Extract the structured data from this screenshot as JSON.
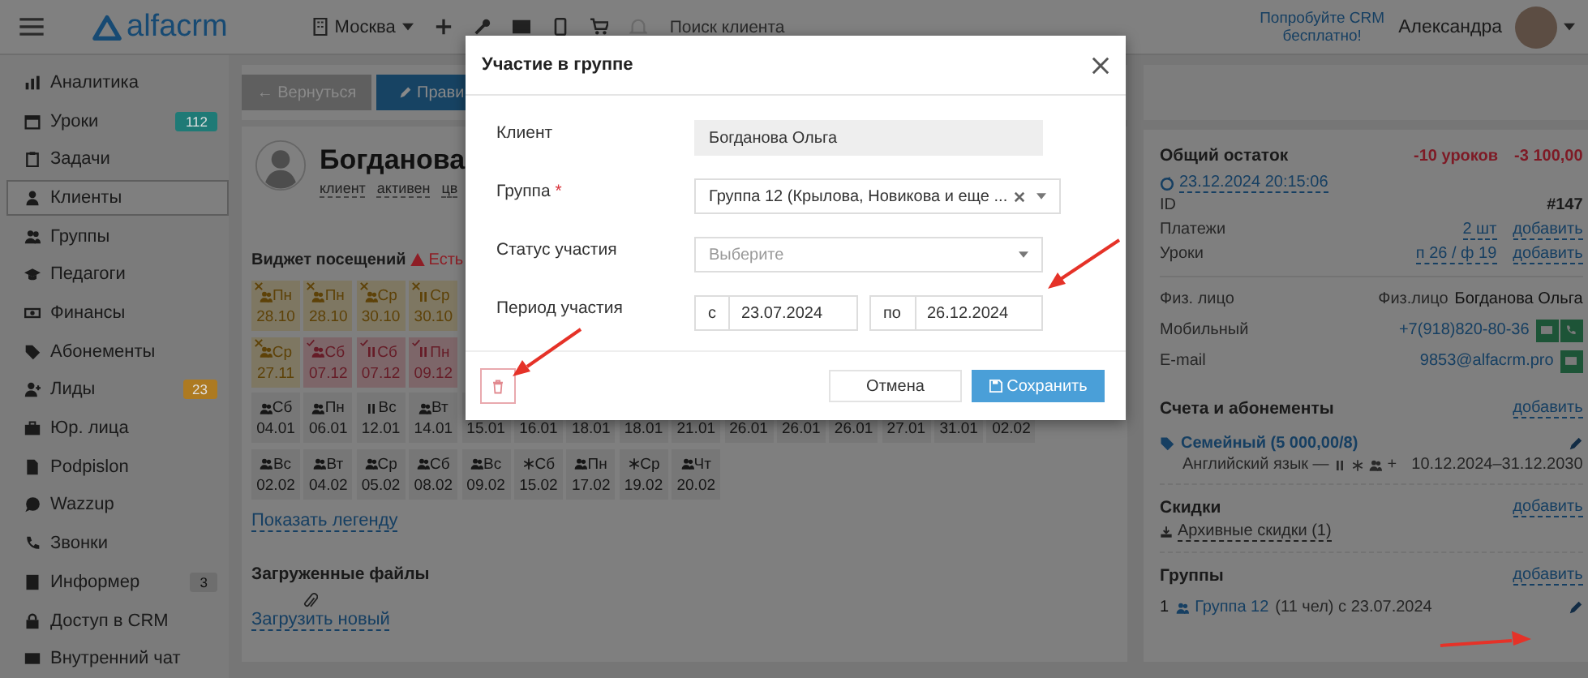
{
  "topbar": {
    "logo": "alfacrm",
    "city": "Москва",
    "search": {
      "placeholder": "Поиск клиента"
    },
    "promo": "Попробуйте CRM бесплатно!",
    "user": "Александра"
  },
  "sidebar": {
    "items": [
      {
        "label": "Аналитика",
        "selected": false
      },
      {
        "label": "Уроки",
        "selected": false,
        "badge": "112",
        "color": "#1f7a76"
      },
      {
        "label": "Задачи",
        "selected": false
      },
      {
        "label": "Клиенты",
        "selected": true
      },
      {
        "label": "Группы",
        "selected": false
      },
      {
        "label": "Педагоги",
        "selected": false
      },
      {
        "label": "Финансы",
        "selected": false
      },
      {
        "label": "Абонементы",
        "selected": false
      },
      {
        "label": "Лиды",
        "selected": false,
        "badge": "23",
        "color": "#ad7a21"
      },
      {
        "label": "Юр. лица",
        "selected": false
      },
      {
        "label": "Podpislon",
        "selected": false
      },
      {
        "label": "Wazzup",
        "selected": false
      },
      {
        "label": "Звонки",
        "selected": false
      },
      {
        "label": "Информер",
        "selected": false,
        "badge": "3",
        "color": "#6e6e6e"
      },
      {
        "label": "Доступ в CRM",
        "selected": false
      },
      {
        "label": "Внутренний чат",
        "selected": false
      }
    ]
  },
  "main": {
    "back_button": "← Вернуться",
    "edit_button": "Прави",
    "client": {
      "name": "Богданова",
      "tags": [
        "клиент",
        "активен",
        "цв"
      ]
    },
    "widget": {
      "title": "Виджет посещений",
      "warning": "Есть",
      "rows": [
        [
          {
            "kind": "group",
            "day": "Пн",
            "date": "28.10",
            "missed": true,
            "attended": false
          },
          {
            "kind": "group",
            "day": "Пн",
            "date": "28.10",
            "missed": true,
            "attended": false
          },
          {
            "kind": "group",
            "day": "Ср",
            "date": "30.10",
            "missed": true,
            "attended": false
          },
          {
            "kind": "individual",
            "day": "Ср",
            "date": "30.10",
            "missed": true,
            "attended": false
          }
        ],
        [
          {
            "kind": "group",
            "day": "Ср",
            "date": "27.11",
            "missed": true,
            "attended": false
          },
          {
            "kind": "group",
            "day": "Сб",
            "date": "07.12",
            "missed": false,
            "attended": true
          },
          {
            "kind": "individual",
            "day": "Сб",
            "date": "07.12",
            "missed": false,
            "attended": true
          },
          {
            "kind": "individual",
            "day": "Пн",
            "date": "09.12",
            "missed": false,
            "attended": true
          }
        ],
        [
          {
            "kind": "group",
            "day": "Сб",
            "date": "04.01",
            "missed": false,
            "attended": false
          },
          {
            "kind": "group",
            "day": "Пн",
            "date": "06.01",
            "missed": false,
            "attended": false
          },
          {
            "kind": "individual",
            "day": "Вс",
            "date": "12.01",
            "missed": false,
            "attended": false
          },
          {
            "kind": "group",
            "day": "Вт",
            "date": "14.01",
            "missed": false,
            "attended": false
          },
          {
            "date": "15.01",
            "missed": false,
            "attended": false
          },
          {
            "date": "16.01",
            "missed": false,
            "attended": false
          },
          {
            "date": "18.01",
            "missed": false,
            "attended": false
          },
          {
            "date": "18.01",
            "missed": false,
            "attended": false
          },
          {
            "date": "21.01",
            "missed": false,
            "attended": false
          },
          {
            "date": "26.01",
            "missed": false,
            "attended": false
          },
          {
            "date": "26.01",
            "missed": false,
            "attended": false
          },
          {
            "date": "26.01",
            "missed": false,
            "attended": false
          },
          {
            "date": "27.01",
            "missed": false,
            "attended": false
          },
          {
            "date": "31.01",
            "missed": false,
            "attended": false
          },
          {
            "date": "02.02",
            "missed": false,
            "attended": false
          }
        ],
        [
          {
            "kind": "group",
            "day": "Вс",
            "date": "02.02",
            "missed": false,
            "attended": false
          },
          {
            "kind": "group",
            "day": "Вт",
            "date": "04.02",
            "missed": false,
            "attended": false
          },
          {
            "kind": "group",
            "day": "Ср",
            "date": "05.02",
            "missed": false,
            "attended": false
          },
          {
            "kind": "group",
            "day": "Сб",
            "date": "08.02",
            "missed": false,
            "attended": false
          },
          {
            "kind": "group",
            "day": "Вс",
            "date": "09.02",
            "missed": false,
            "attended": false
          },
          {
            "kind": "trial",
            "day": "Сб",
            "date": "15.02",
            "missed": false,
            "attended": false
          },
          {
            "kind": "group",
            "day": "Пн",
            "date": "17.02",
            "missed": false,
            "attended": false
          },
          {
            "kind": "trial",
            "day": "Ср",
            "date": "19.02",
            "missed": false,
            "attended": false
          },
          {
            "kind": "group",
            "day": "Чт",
            "date": "20.02",
            "missed": false,
            "attended": false
          }
        ]
      ],
      "legend_link": "Показать легенду"
    },
    "files": {
      "title": "Загруженные файлы",
      "upload_link": "Загрузить новый"
    }
  },
  "info": {
    "balance": {
      "title": "Общий остаток",
      "lessons": "-10 уроков",
      "amount": "-3 100,00",
      "updated": "23.12.2024 20:15:06"
    },
    "rows": [
      {
        "label": "ID",
        "value": "#147"
      },
      {
        "label": "Платежи",
        "value": "2 шт",
        "action": "добавить"
      },
      {
        "label": "Уроки",
        "value": "п 26 / ф 19",
        "action": "добавить"
      }
    ],
    "contacts": [
      {
        "label": "Физ. лицо",
        "prefix": "Физ.лицо",
        "value": "Богданова Ольга"
      },
      {
        "label": "Мобильный",
        "value": "+7(918)820-80-36",
        "message": true,
        "call": true
      },
      {
        "label": "E-mail",
        "value": "9853@alfacrm.pro",
        "message": true
      }
    ],
    "accounts": {
      "title": "Счета и абонементы",
      "action": "добавить",
      "name": "Семейный (5 000,00/8)",
      "subject": "Английский язык —",
      "extra": "+",
      "period": "10.12.2024–31.12.2030"
    },
    "discounts": {
      "title": "Скидки",
      "action": "добавить",
      "archive": "Архивные скидки (1)"
    },
    "groups": {
      "title": "Группы",
      "action": "добавить",
      "count": "1",
      "name": "Группа 12",
      "details": "(11 чел) с 23.07.2024"
    }
  },
  "modal": {
    "title": "Участие в группе",
    "fields": [
      {
        "kind": "readonly",
        "label": "Клиент",
        "value": "Богданова Ольга"
      },
      {
        "kind": "select",
        "label": "Группа",
        "required_mark": "*",
        "value": "Группа 12 (Крылова, Новикова и еще ...",
        "clearable": true
      },
      {
        "kind": "select",
        "label": "Статус участия",
        "placeholder": "Выберите",
        "clearable": false
      },
      {
        "kind": "period",
        "label": "Период участия",
        "from_label": "с",
        "from": "23.07.2024",
        "to_label": "по",
        "to": "26.12.2024"
      }
    ],
    "cancel": "Отмена",
    "save": "Сохранить"
  }
}
